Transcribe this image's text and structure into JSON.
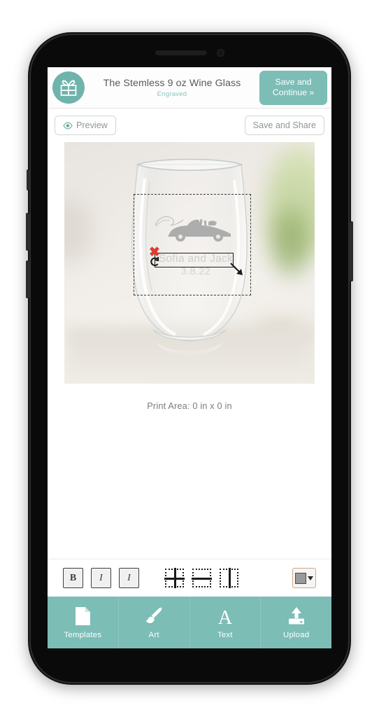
{
  "header": {
    "logo_icon": "gift-box-icon",
    "product_title": "The Stemless 9 oz Wine Glass",
    "product_subtitle": "Engraved",
    "save_continue_label": "Save and Continue »",
    "accent_color": "#7cbdb6",
    "subtitle_color": "#8fc3bd"
  },
  "action_bar": {
    "preview_label": "Preview",
    "preview_icon": "eye-icon",
    "save_share_label": "Save and Share"
  },
  "design": {
    "print_area_caption": "Print Area: 0 in x 0 in",
    "art_name": "wedding-car-art",
    "text_object": {
      "names": "Sofia and Jack",
      "date": "3.8.22",
      "text_color": "#cfcfcf",
      "delete_glyph": "✖",
      "delete_color": "#e03a2f"
    }
  },
  "format_toolbar": {
    "style_buttons": [
      {
        "name": "bold-button",
        "label": "B"
      },
      {
        "name": "italic-button",
        "label": "I"
      },
      {
        "name": "underline-button",
        "label": "I"
      }
    ],
    "align_buttons": [
      {
        "name": "align-center-both",
        "label": "Center both"
      },
      {
        "name": "align-center-horizontal",
        "label": "Center horizontally"
      },
      {
        "name": "align-center-vertical",
        "label": "Center vertically"
      }
    ],
    "color_picker": {
      "name": "color-picker-button",
      "swatch_color": "#9a9a9a",
      "caret_icon": "chevron-down-icon"
    }
  },
  "bottom_nav": {
    "background": "#7cbdb6",
    "items": [
      {
        "label": "Templates",
        "icon": "document-icon"
      },
      {
        "label": "Art",
        "icon": "paintbrush-icon"
      },
      {
        "label": "Text",
        "icon": "letter-a-icon"
      },
      {
        "label": "Upload",
        "icon": "upload-arrow-icon"
      }
    ]
  }
}
